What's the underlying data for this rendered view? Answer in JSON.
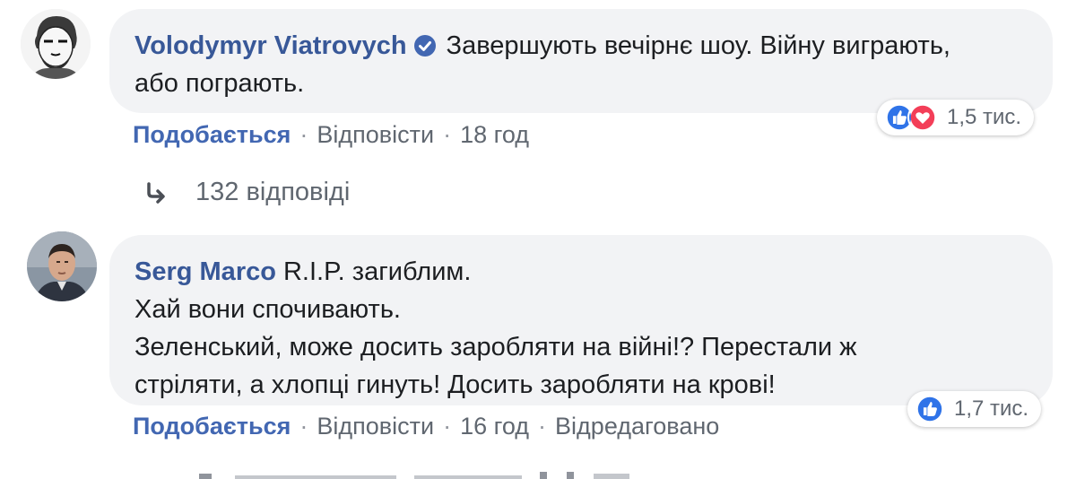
{
  "comments": [
    {
      "author": "Volodymyr Viatrovych",
      "verified": true,
      "text_lines": [
        "Завершують вечірнє шоу. Війну виграють,",
        "або пограють."
      ],
      "reactions": {
        "icons": [
          "like-icon",
          "love-icon"
        ],
        "count": "1,5 тис."
      },
      "actions": {
        "like": "Подобається",
        "reply": "Відповісти",
        "time": "18 год"
      }
    },
    {
      "author": "Serg Marco",
      "verified": false,
      "text_lines": [
        "R.I.P. загиблим.",
        "Хай вони спочивають.",
        "Зеленський, може досить заробляти на війні!? Перестали ж",
        "стріляти, а хлопці гинуть! Досить заробляти на крові!"
      ],
      "reactions": {
        "icons": [
          "like-icon"
        ],
        "count": "1,7 тис."
      },
      "actions": {
        "like": "Подобається",
        "reply": "Відповісти",
        "time": "16 год",
        "edited": "Відредаговано"
      }
    }
  ],
  "replies_link": {
    "text": "132 відповіді",
    "icon": "reply-arrow-icon"
  },
  "colors": {
    "link": "#385898",
    "like_action": "#4267b2",
    "muted": "#606770",
    "bubble": "#f2f3f5",
    "love": "#f33e58"
  }
}
